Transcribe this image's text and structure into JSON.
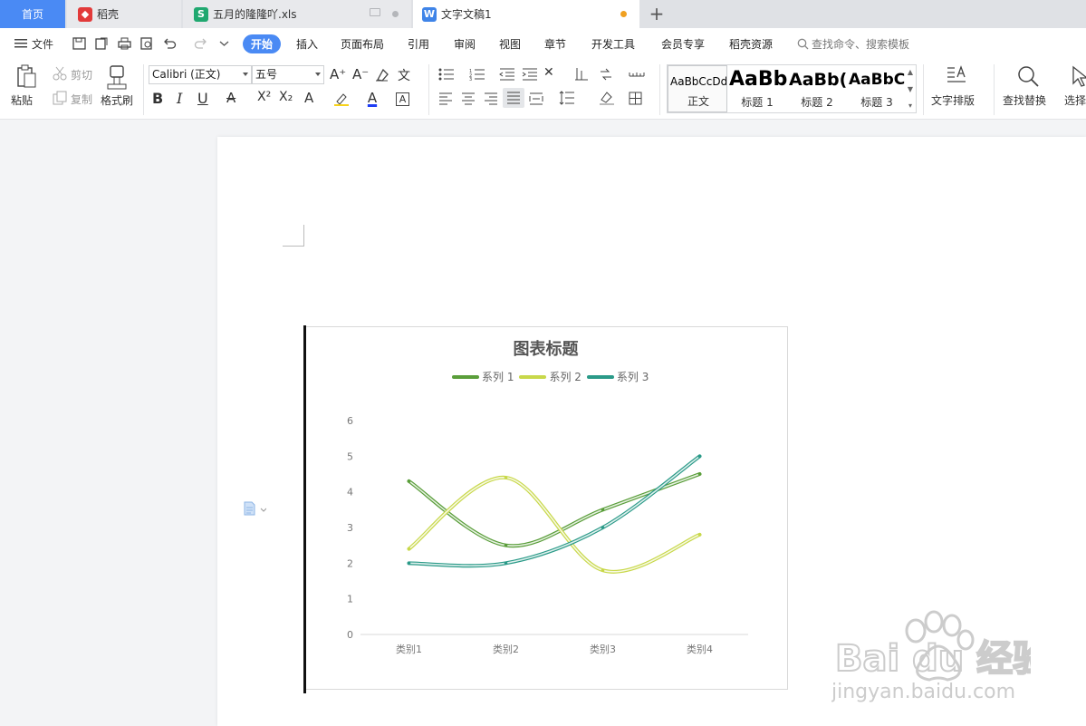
{
  "tabs": {
    "home": "首页",
    "daoke": "稻壳",
    "xls": "五月的隆隆吖.xls",
    "doc": "文字文稿1",
    "plus": "+"
  },
  "menu": {
    "file": "文件",
    "items": [
      "开始",
      "插入",
      "页面布局",
      "引用",
      "审阅",
      "视图",
      "章节",
      "开发工具",
      "会员专享",
      "稻壳资源"
    ],
    "search_placeholder": "查找命令、搜索模板"
  },
  "toolbar": {
    "paste": "粘贴",
    "cut": "剪切",
    "copy": "复制",
    "format_painter": "格式刷",
    "font_name": "Calibri (正文)",
    "font_size": "五号",
    "bold": "B",
    "italic": "I",
    "underline": "U",
    "styles": [
      {
        "preview": "AaBbCcDd",
        "name": "正文"
      },
      {
        "preview": "AaBb",
        "name": "标题 1"
      },
      {
        "preview": "AaBb(",
        "name": "标题 2"
      },
      {
        "preview": "AaBbC",
        "name": "标题 3"
      }
    ],
    "text_layout": "文字排版",
    "find_replace": "查找替换",
    "select": "选择"
  },
  "chart_data": {
    "type": "line",
    "title": "图表标题",
    "categories": [
      "类别1",
      "类别2",
      "类别3",
      "类别4"
    ],
    "series": [
      {
        "name": "系列 1",
        "values": [
          4.3,
          2.5,
          3.5,
          4.5
        ],
        "color": "#5a9e3a"
      },
      {
        "name": "系列 2",
        "values": [
          2.4,
          4.4,
          1.8,
          2.8
        ],
        "color": "#c8d84a"
      },
      {
        "name": "系列 3",
        "values": [
          2.0,
          2.0,
          3.0,
          5.0
        ],
        "color": "#2a9a88"
      }
    ],
    "yticks": [
      "0",
      "1",
      "2",
      "3",
      "4",
      "5",
      "6"
    ],
    "ylim": [
      0,
      6
    ],
    "legend": "top",
    "smooth": true
  },
  "watermark": {
    "brand": "Bai du 经验",
    "url": "jingyan.baidu.com"
  },
  "colors": {
    "accent": "#4a8af4",
    "tab_bar": "#dfe1e5"
  }
}
